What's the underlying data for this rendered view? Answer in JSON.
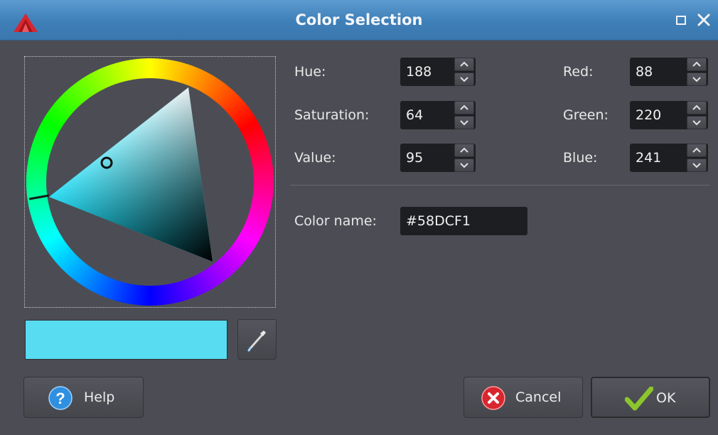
{
  "window": {
    "title": "Color Selection"
  },
  "hsv": {
    "hue_label": "Hue:",
    "hue_value": "188",
    "saturation_label": "Saturation:",
    "saturation_value": "64",
    "value_label": "Value:",
    "value_value": "95"
  },
  "rgb": {
    "red_label": "Red:",
    "red_value": "88",
    "green_label": "Green:",
    "green_value": "220",
    "blue_label": "Blue:",
    "blue_value": "241"
  },
  "color_name": {
    "label": "Color name:",
    "value": "#58DCF1"
  },
  "preview": {
    "color": "#58DCF1"
  },
  "buttons": {
    "help_label": "Help",
    "cancel_label": "Cancel",
    "ok_label": "OK"
  },
  "icons": {
    "app": "app-logo-icon",
    "maximize": "maximize-icon",
    "close": "close-icon",
    "picker": "eyedropper-icon",
    "help": "question-icon",
    "cancel": "cancel-x-icon",
    "ok": "checkmark-icon"
  }
}
